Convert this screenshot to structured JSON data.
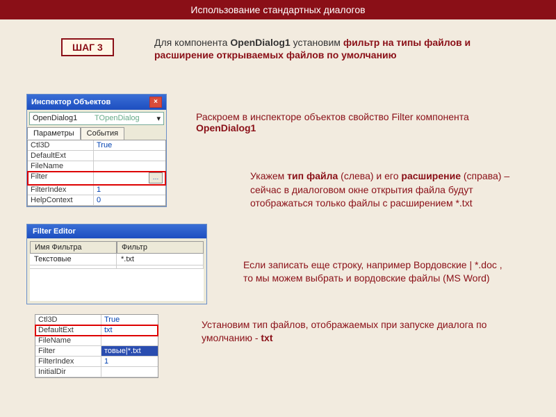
{
  "header": "Использование стандартных диалогов",
  "step": "ШАГ 3",
  "intro": {
    "t1": "Для компонента ",
    "t2": "OpenDialog1",
    "t3": " установим ",
    "t4": "фильтр на типы файлов и расширение открываемых файлов по умолчанию"
  },
  "inspector": {
    "title": "Инспектор Объектов",
    "close": "×",
    "combo_name": "OpenDialog1",
    "combo_type": "TOpenDialog",
    "combo_caret": "▾",
    "tab_params": "Параметры",
    "tab_events": "События",
    "rows": [
      {
        "l": "Ctl3D",
        "r": "True"
      },
      {
        "l": "DefaultExt",
        "r": ""
      },
      {
        "l": "FileName",
        "r": ""
      },
      {
        "l": "Filter",
        "r": ""
      },
      {
        "l": "FilterIndex",
        "r": "1"
      },
      {
        "l": "HelpContext",
        "r": "0"
      }
    ],
    "ellipsis": "…"
  },
  "caption1": {
    "a": "Раскроем в инспекторе объектов свойство Filter компонента ",
    "b": "OpenDialog1"
  },
  "filter_editor": {
    "title": "Filter Editor",
    "col1": "Имя Фильтра",
    "col2": "Фильтр",
    "row_name": "Текстовые",
    "row_filter": "*.txt"
  },
  "caption2": {
    "a": "Укажем ",
    "b": "тип файла",
    "c": " (слева) и его ",
    "d": "расширение",
    "e": " (справа) – сейчас в диалоговом окне открытия файла будут отображаться только файлы с расширением *.txt"
  },
  "caption3": "Если записать еще строку, например Вордовские | *.doc , то мы можем выбрать и вордовские файлы (MS Word)",
  "caption4": {
    "a": "Установим тип файлов, отображаемых при запуске диалога по умолчанию - ",
    "b": "txt"
  },
  "inspector2": {
    "rows": [
      {
        "l": "Ctl3D",
        "r": "True"
      },
      {
        "l": "DefaultExt",
        "r": "txt"
      },
      {
        "l": "FileName",
        "r": ""
      },
      {
        "l": "Filter",
        "r": "товые|*.txt"
      },
      {
        "l": "FilterIndex",
        "r": "1"
      },
      {
        "l": "InitialDir",
        "r": ""
      }
    ]
  }
}
